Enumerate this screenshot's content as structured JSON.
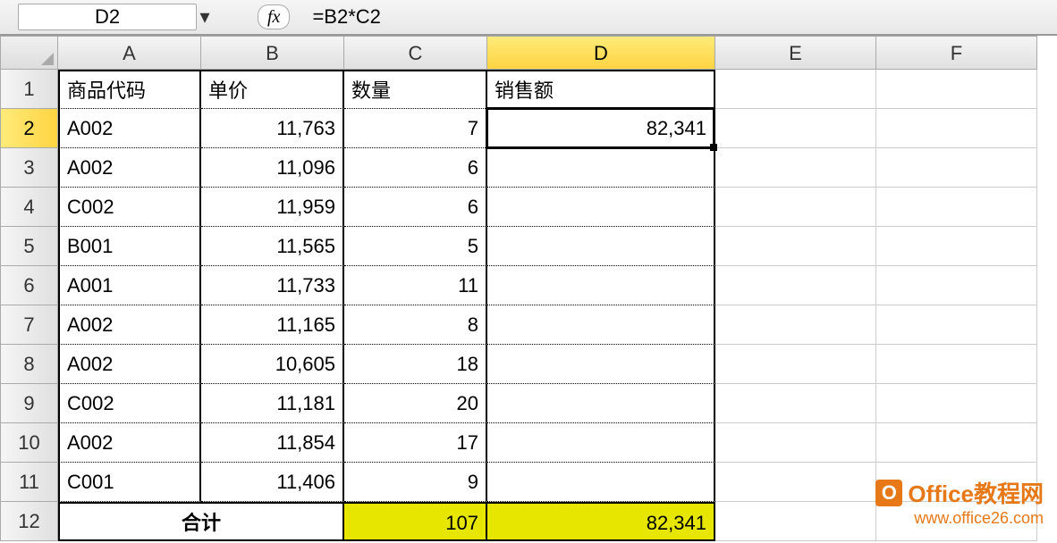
{
  "formula_bar": {
    "name_box": "D2",
    "fx_label": "fx",
    "formula": "=B2*C2"
  },
  "columns": [
    "A",
    "B",
    "C",
    "D",
    "E",
    "F"
  ],
  "rows": [
    "1",
    "2",
    "3",
    "4",
    "5",
    "6",
    "7",
    "8",
    "9",
    "10",
    "11",
    "12"
  ],
  "active_cell": "D2",
  "headers": {
    "A": "商品代码",
    "B": "单价",
    "C": "数量",
    "D": "销售额"
  },
  "data": [
    {
      "code": "A002",
      "price": "11,763",
      "qty": "7",
      "sales": "82,341"
    },
    {
      "code": "A002",
      "price": "11,096",
      "qty": "6",
      "sales": ""
    },
    {
      "code": "C002",
      "price": "11,959",
      "qty": "6",
      "sales": ""
    },
    {
      "code": "B001",
      "price": "11,565",
      "qty": "5",
      "sales": ""
    },
    {
      "code": "A001",
      "price": "11,733",
      "qty": "11",
      "sales": ""
    },
    {
      "code": "A002",
      "price": "11,165",
      "qty": "8",
      "sales": ""
    },
    {
      "code": "A002",
      "price": "10,605",
      "qty": "18",
      "sales": ""
    },
    {
      "code": "C002",
      "price": "11,181",
      "qty": "20",
      "sales": ""
    },
    {
      "code": "A002",
      "price": "11,854",
      "qty": "17",
      "sales": ""
    },
    {
      "code": "C001",
      "price": "11,406",
      "qty": "9",
      "sales": ""
    }
  ],
  "totals": {
    "label": "合计",
    "qty": "107",
    "sales": "82,341"
  },
  "watermark": {
    "title": "Office教程网",
    "url": "www.office26.com",
    "icon_letter": "O"
  }
}
